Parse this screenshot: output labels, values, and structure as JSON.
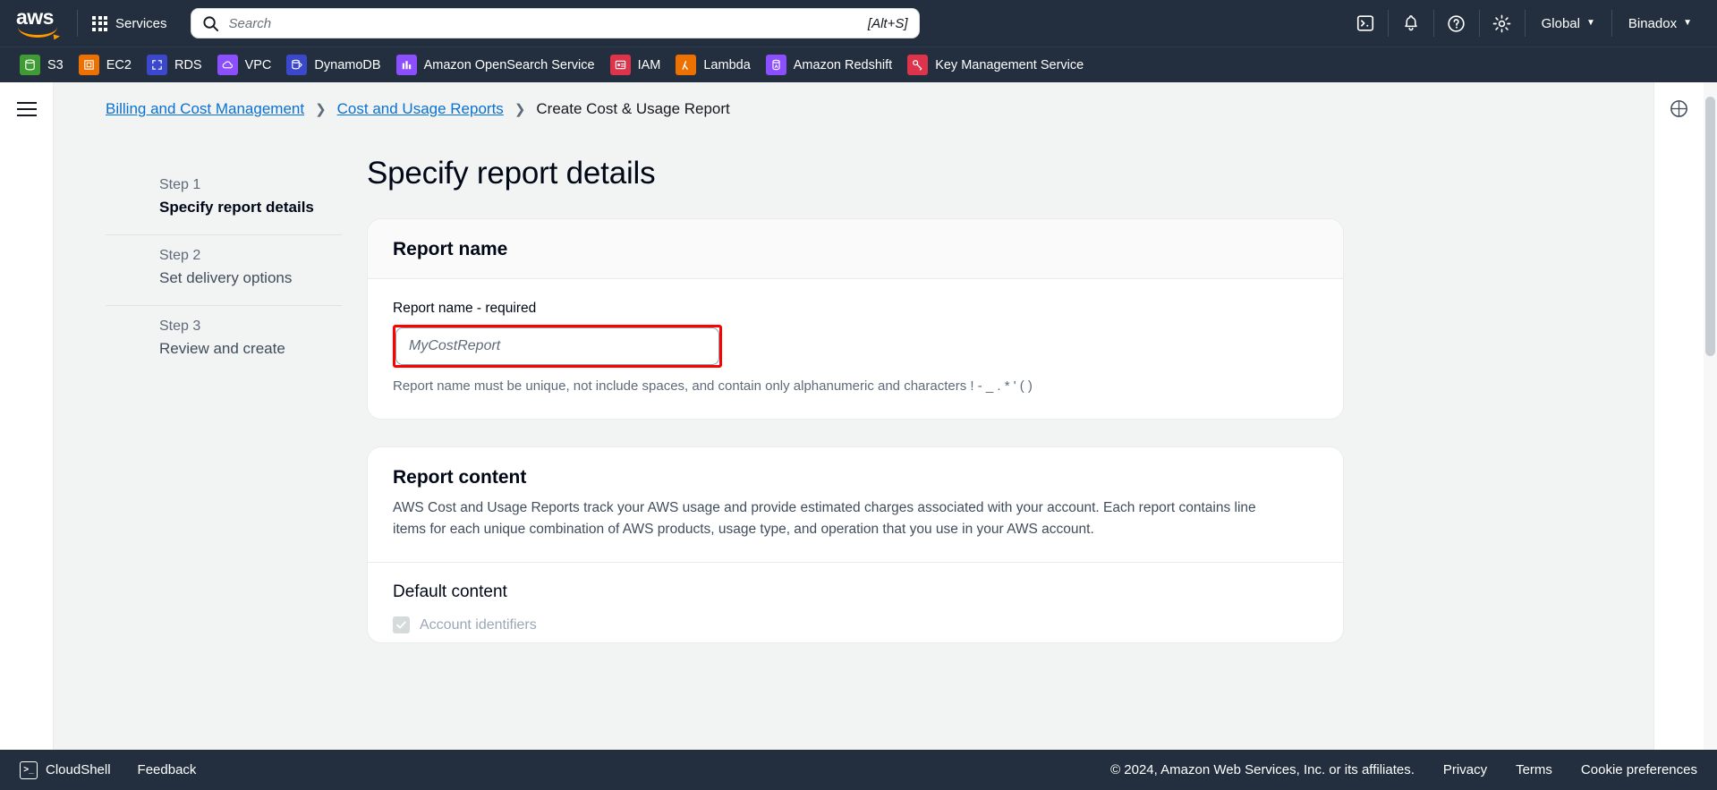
{
  "topnav": {
    "logo_alt": "aws",
    "services_label": "Services",
    "search": {
      "placeholder": "Search",
      "value": "",
      "shortcut": "[Alt+S]"
    },
    "icons": [
      {
        "name": "cloudshell-icon",
        "glyph": ">_"
      },
      {
        "name": "notifications-bell-icon",
        "glyph": "bell"
      },
      {
        "name": "help-question-icon",
        "glyph": "?"
      },
      {
        "name": "settings-gear-icon",
        "glyph": "gear"
      }
    ],
    "region_label": "Global",
    "account_label": "Binadox",
    "caret": "▼"
  },
  "service_bar": {
    "items": [
      {
        "label": "S3",
        "color": "#3f9c35",
        "icon": "s3-bucket-icon"
      },
      {
        "label": "EC2",
        "color": "#ed7100",
        "icon": "ec2-instance-icon"
      },
      {
        "label": "RDS",
        "color": "#3b48cc",
        "icon": "rds-database-icon"
      },
      {
        "label": "VPC",
        "color": "#8c4fff",
        "icon": "vpc-cloud-icon"
      },
      {
        "label": "DynamoDB",
        "color": "#3b48cc",
        "icon": "dynamodb-icon"
      },
      {
        "label": "Amazon OpenSearch Service",
        "color": "#8c4fff",
        "icon": "opensearch-icon"
      },
      {
        "label": "IAM",
        "color": "#dd344c",
        "icon": "iam-badge-icon"
      },
      {
        "label": "Lambda",
        "color": "#ed7100",
        "icon": "lambda-icon"
      },
      {
        "label": "Amazon Redshift",
        "color": "#8c4fff",
        "icon": "redshift-icon"
      },
      {
        "label": "Key Management Service",
        "color": "#dd344c",
        "icon": "kms-key-icon"
      }
    ]
  },
  "breadcrumb": {
    "items": [
      {
        "label": "Billing and Cost Management",
        "link": true
      },
      {
        "label": "Cost and Usage Reports",
        "link": true
      },
      {
        "label": "Create Cost & Usage Report",
        "link": false
      }
    ],
    "separator": "❯"
  },
  "wizard": {
    "steps": [
      {
        "step": "Step 1",
        "title": "Specify report details",
        "active": true
      },
      {
        "step": "Step 2",
        "title": "Set delivery options",
        "active": false
      },
      {
        "step": "Step 3",
        "title": "Review and create",
        "active": false
      }
    ]
  },
  "main": {
    "page_title": "Specify report details",
    "report_name_card": {
      "title": "Report name",
      "field_label": "Report name - required",
      "input_placeholder": "MyCostReport",
      "input_value": "",
      "hint": "Report name must be unique, not include spaces, and contain only alphanumeric and characters ! - _ . * ' ( )",
      "highlight_color": "#ff0000"
    },
    "report_content_card": {
      "title": "Report content",
      "description": "AWS Cost and Usage Reports track your AWS usage and provide estimated charges associated with your account. Each report contains line items for each unique combination of AWS products, usage type, and operation that you use in your AWS account.",
      "subsection_title": "Default content",
      "checkbox_label": "Account identifiers",
      "checkbox_checked": true,
      "checkbox_disabled": true
    }
  },
  "footer": {
    "cloudshell_label": "CloudShell",
    "cloudshell_glyph": ">_",
    "feedback_label": "Feedback",
    "copyright": "© 2024, Amazon Web Services, Inc. or its affiliates.",
    "links": [
      "Privacy",
      "Terms",
      "Cookie preferences"
    ]
  }
}
